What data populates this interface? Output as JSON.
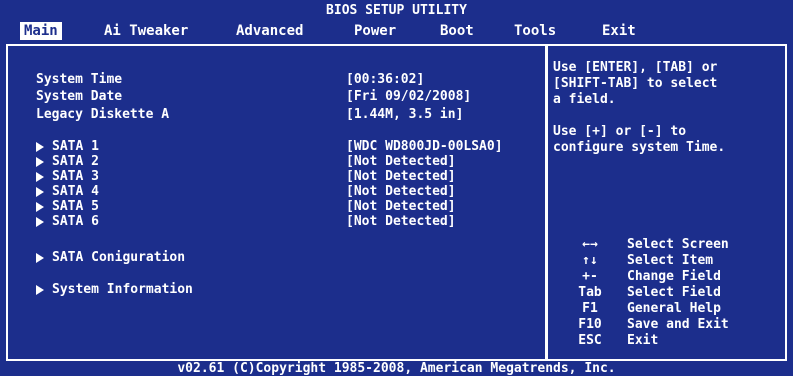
{
  "title": "BIOS SETUP UTILITY",
  "menu": [
    {
      "label": "Main",
      "active": true
    },
    {
      "label": "Ai Tweaker",
      "active": false
    },
    {
      "label": "Advanced",
      "active": false
    },
    {
      "label": "Power",
      "active": false
    },
    {
      "label": "Boot",
      "active": false
    },
    {
      "label": "Tools",
      "active": false
    },
    {
      "label": "Exit",
      "active": false
    }
  ],
  "settings": [
    {
      "label": "System Time",
      "value": "[00:36:02]"
    },
    {
      "label": "System Date",
      "value": "[Fri 09/02/2008]"
    },
    {
      "label": "Legacy Diskette A",
      "value": "[1.44M, 3.5 in]"
    }
  ],
  "sata": [
    {
      "label": "SATA 1",
      "value": "[WDC WD800JD-00LSA0]"
    },
    {
      "label": "SATA 2",
      "value": "[Not Detected]"
    },
    {
      "label": "SATA 3",
      "value": "[Not Detected]"
    },
    {
      "label": "SATA 4",
      "value": "[Not Detected]"
    },
    {
      "label": "SATA 5",
      "value": "[Not Detected]"
    },
    {
      "label": "SATA 6",
      "value": "[Not Detected]"
    }
  ],
  "submenus": [
    {
      "label": "SATA Coniguration"
    },
    {
      "label": "System Information"
    }
  ],
  "help": [
    "Use [ENTER], [TAB] or",
    "[SHIFT-TAB] to select",
    "a field.",
    "",
    "Use [+] or [-] to",
    "configure system Time."
  ],
  "keys": [
    {
      "key": "←→",
      "desc": "Select Screen"
    },
    {
      "key": "↑↓",
      "desc": "Select Item"
    },
    {
      "key": "+-",
      "desc": "Change Field"
    },
    {
      "key": "Tab",
      "desc": "Select Field"
    },
    {
      "key": "F1",
      "desc": "General Help"
    },
    {
      "key": "F10",
      "desc": "Save and Exit"
    },
    {
      "key": "ESC",
      "desc": "Exit"
    }
  ],
  "footer": "v02.61 (C)Copyright 1985-2008, American Megatrends, Inc.",
  "colors": {
    "background": "#1c2e8c",
    "text": "#ffffff",
    "highlight": "#ffffff"
  }
}
